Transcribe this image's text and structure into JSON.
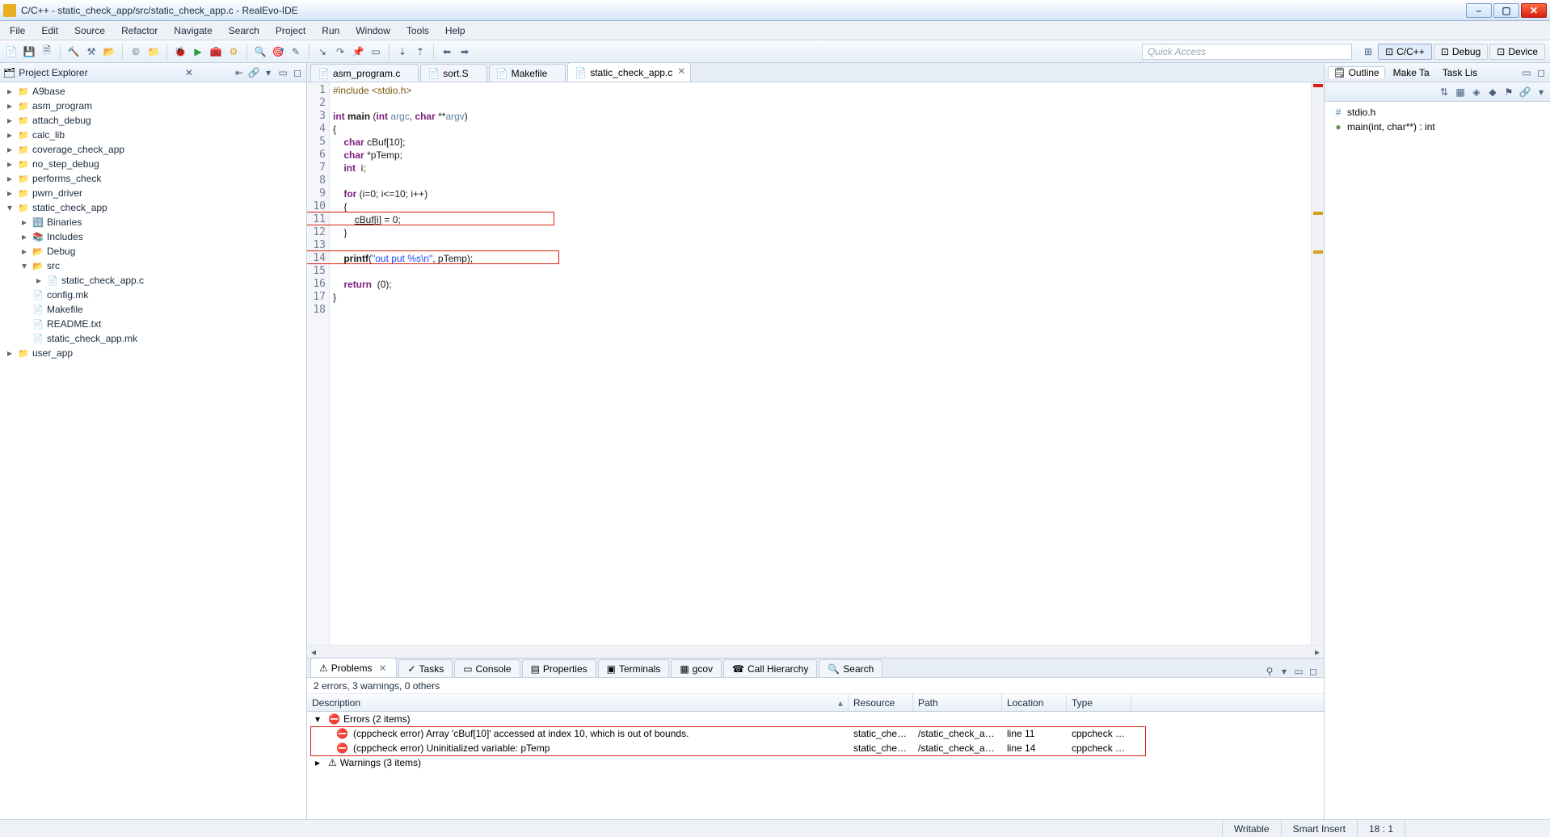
{
  "title": "C/C++ - static_check_app/src/static_check_app.c - RealEvo-IDE",
  "menus": [
    "File",
    "Edit",
    "Source",
    "Refactor",
    "Navigate",
    "Search",
    "Project",
    "Run",
    "Window",
    "Tools",
    "Help"
  ],
  "quick_access_placeholder": "Quick Access",
  "perspectives": [
    {
      "label": "C/C++",
      "active": true
    },
    {
      "label": "Debug",
      "active": false
    },
    {
      "label": "Device",
      "active": false
    }
  ],
  "project_explorer": {
    "title": "Project Explorer",
    "items": [
      {
        "indent": 0,
        "exp": "▸",
        "icon": "📁",
        "label": "A9base"
      },
      {
        "indent": 0,
        "exp": "▸",
        "icon": "📁",
        "label": "asm_program"
      },
      {
        "indent": 0,
        "exp": "▸",
        "icon": "📁",
        "label": "attach_debug"
      },
      {
        "indent": 0,
        "exp": "▸",
        "icon": "📁",
        "label": "calc_lib"
      },
      {
        "indent": 0,
        "exp": "▸",
        "icon": "📁",
        "label": "coverage_check_app"
      },
      {
        "indent": 0,
        "exp": "▸",
        "icon": "📁",
        "label": "no_step_debug"
      },
      {
        "indent": 0,
        "exp": "▸",
        "icon": "📁",
        "label": "performs_check"
      },
      {
        "indent": 0,
        "exp": "▸",
        "icon": "📁",
        "label": "pwm_driver"
      },
      {
        "indent": 0,
        "exp": "▾",
        "icon": "📁",
        "label": "static_check_app"
      },
      {
        "indent": 1,
        "exp": "▸",
        "icon": "🔢",
        "label": "Binaries"
      },
      {
        "indent": 1,
        "exp": "▸",
        "icon": "📚",
        "label": "Includes"
      },
      {
        "indent": 1,
        "exp": "▸",
        "icon": "📂",
        "label": "Debug"
      },
      {
        "indent": 1,
        "exp": "▾",
        "icon": "📂",
        "label": "src"
      },
      {
        "indent": 2,
        "exp": "▸",
        "icon": "📄",
        "label": "static_check_app.c"
      },
      {
        "indent": 1,
        "exp": "",
        "icon": "📄",
        "label": "config.mk"
      },
      {
        "indent": 1,
        "exp": "",
        "icon": "📄",
        "label": "Makefile"
      },
      {
        "indent": 1,
        "exp": "",
        "icon": "📄",
        "label": "README.txt"
      },
      {
        "indent": 1,
        "exp": "",
        "icon": "📄",
        "label": "static_check_app.mk"
      },
      {
        "indent": 0,
        "exp": "▸",
        "icon": "📁",
        "label": "user_app"
      }
    ]
  },
  "editor_tabs": [
    {
      "label": "asm_program.c",
      "active": false
    },
    {
      "label": "sort.S",
      "active": false
    },
    {
      "label": "Makefile",
      "active": false
    },
    {
      "label": "static_check_app.c",
      "active": true
    }
  ],
  "code_lines": [
    {
      "n": 1,
      "html": "<span class='pp'>#include &lt;stdio.h&gt;</span>"
    },
    {
      "n": 2,
      "html": ""
    },
    {
      "n": 3,
      "html": "<span class='kw'>int</span> <b>main</b> (<span class='kw'>int</span> <span class='cm'>argc</span>, <span class='kw'>char</span> **<span class='cm'>argv</span>)"
    },
    {
      "n": 4,
      "html": "{"
    },
    {
      "n": 5,
      "html": "    <span class='kw'>char</span> cBuf[10];"
    },
    {
      "n": 6,
      "html": "    <span class='kw'>char</span> *pTemp;"
    },
    {
      "n": 7,
      "html": "    <span class='kw'>int</span>  i;"
    },
    {
      "n": 8,
      "html": ""
    },
    {
      "n": 9,
      "html": "    <span class='kw'>for</span> (i=0; i&lt;=10; i++)"
    },
    {
      "n": 10,
      "html": "    {"
    },
    {
      "n": 11,
      "html": "        <u>cBuf</u>[<u>i</u>] = 0;",
      "err": true
    },
    {
      "n": 12,
      "html": "    }"
    },
    {
      "n": 13,
      "html": ""
    },
    {
      "n": 14,
      "html": "    <b>printf</b>(<span class='str'>\"out put %s\\n\"</span>, pTemp);",
      "err": true
    },
    {
      "n": 15,
      "html": ""
    },
    {
      "n": 16,
      "html": "    <span class='kw'>return</span>  (0);"
    },
    {
      "n": 17,
      "html": "}"
    },
    {
      "n": 18,
      "html": ""
    }
  ],
  "outline": {
    "tabs": [
      "Outline",
      "Make Ta",
      "Task Lis"
    ],
    "items": [
      {
        "icon": "#",
        "label": "stdio.h",
        "color": "#4a80c0"
      },
      {
        "icon": "●",
        "label": "main(int, char**) : int",
        "color": "#5a9a4a"
      }
    ]
  },
  "problems": {
    "tabs": [
      {
        "label": "Problems",
        "active": true,
        "close": true
      },
      {
        "label": "Tasks"
      },
      {
        "label": "Console"
      },
      {
        "label": "Properties"
      },
      {
        "label": "Terminals"
      },
      {
        "label": "gcov"
      },
      {
        "label": "Call Hierarchy"
      },
      {
        "label": "Search"
      }
    ],
    "summary": "2 errors, 3 warnings, 0 others",
    "columns": [
      "Description",
      "Resource",
      "Path",
      "Location",
      "Type"
    ],
    "groups": [
      {
        "exp": "▾",
        "icon": "⛔",
        "label": "Errors (2 items)"
      },
      {
        "row": true,
        "icon": "⛔",
        "desc": "(cppcheck error) Array 'cBuf[10]' accessed at index 10, which is out of bounds.",
        "res": "static_chec...",
        "path": "/static_check_ap...",
        "loc": "line 11",
        "type": "cppcheck P..."
      },
      {
        "row": true,
        "icon": "⛔",
        "desc": "(cppcheck error) Uninitialized variable: pTemp",
        "res": "static_chec...",
        "path": "/static_check_ap...",
        "loc": "line 14",
        "type": "cppcheck P..."
      },
      {
        "exp": "▸",
        "icon": "⚠",
        "label": "Warnings (3 items)"
      }
    ]
  },
  "status": {
    "writable": "Writable",
    "insert": "Smart Insert",
    "pos": "18 : 1"
  }
}
